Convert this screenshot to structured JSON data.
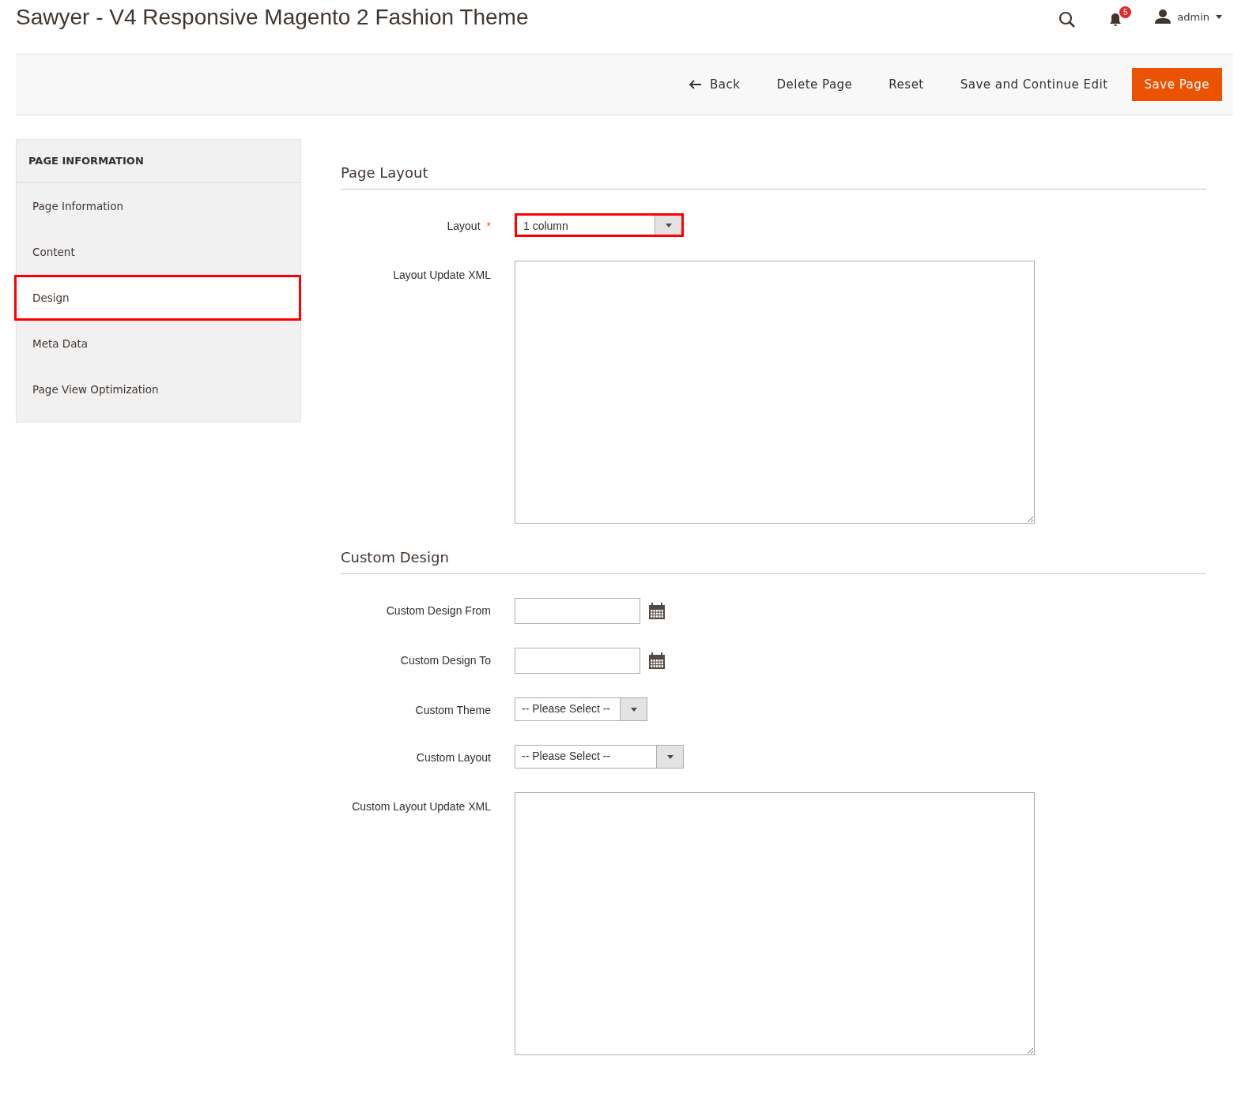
{
  "header": {
    "title": "Sawyer - V4 Responsive Magento 2 Fashion Theme",
    "notifications": "5",
    "user": "admin"
  },
  "toolbar": {
    "back": "Back",
    "buttons": [
      {
        "label": "Delete Page",
        "kind": "plain"
      },
      {
        "label": "Reset",
        "kind": "plain"
      },
      {
        "label": "Save and Continue Edit",
        "kind": "plain"
      },
      {
        "label": "Save Page",
        "kind": "primary"
      }
    ]
  },
  "sidebar": {
    "title": "PAGE INFORMATION",
    "items": [
      {
        "label": "Page Information",
        "selected": false,
        "highlighted": false
      },
      {
        "label": "Content",
        "selected": false,
        "highlighted": false
      },
      {
        "label": "Design",
        "selected": true,
        "highlighted": true
      },
      {
        "label": "Meta Data",
        "selected": false,
        "highlighted": false
      },
      {
        "label": "Page View Optimization",
        "selected": false,
        "highlighted": false
      }
    ]
  },
  "sections": [
    {
      "title": "Page Layout",
      "fields": [
        {
          "label": "Layout",
          "kind": "select",
          "value": "1 column",
          "required_mark": "*",
          "highlighted": true,
          "wide": true
        },
        {
          "label": "Layout Update XML",
          "kind": "textarea",
          "highlighted": false
        }
      ]
    },
    {
      "title": "Custom Design",
      "fields": [
        {
          "label": "Custom Design From",
          "kind": "date",
          "highlighted": false
        },
        {
          "label": "Custom Design To",
          "kind": "date",
          "highlighted": false
        },
        {
          "label": "Custom Theme",
          "kind": "select",
          "value": "-- Please Select --",
          "highlighted": false,
          "wide": false
        },
        {
          "label": "Custom Layout",
          "kind": "select",
          "value": "-- Please Select --",
          "highlighted": false,
          "wide": true
        },
        {
          "label": "Custom Layout Update XML",
          "kind": "textarea",
          "highlighted": false
        }
      ]
    }
  ]
}
